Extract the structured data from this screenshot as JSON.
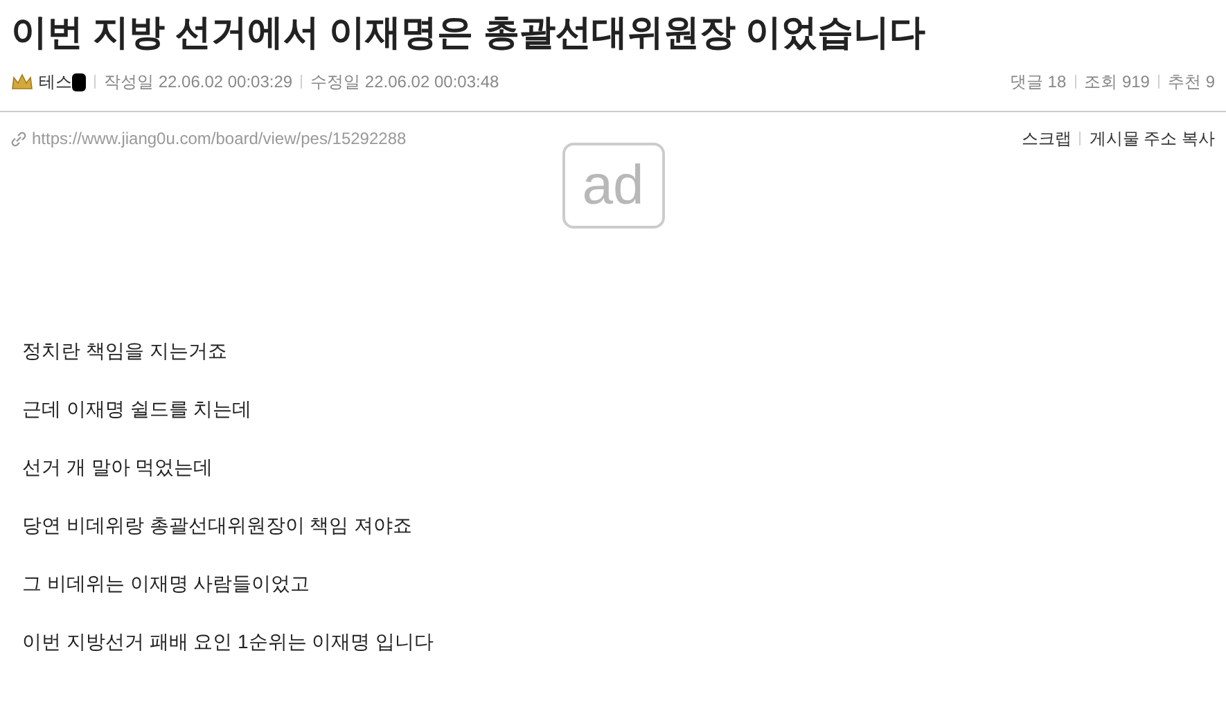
{
  "post": {
    "title": "이번 지방 선거에서 이재명은 총괄선대위원장 이었습니다",
    "author": "테스",
    "author_redacted": true,
    "written_label": "작성일",
    "written": "22.06.02 00:03:29",
    "edited_label": "수정일",
    "edited": "22.06.02 00:03:48",
    "stats": [
      {
        "label": "댓글",
        "value": "18"
      },
      {
        "label": "조회",
        "value": "919"
      },
      {
        "label": "추천",
        "value": "9"
      }
    ],
    "url": "https://www.jiang0u.com/board/view/pes/15292288",
    "actions": [
      "스크랩",
      "게시물 주소 복사"
    ],
    "ad": "ad",
    "body": [
      "정치란 책임을 지는거죠",
      "근데 이재명 쉴드를 치는데",
      "선거 개 말아 먹었는데",
      "당연 비데위랑 총괄선대위원장이 책임 져야죠",
      "그 비데위는 이재명 사람들이었고",
      "이번 지방선거 패배 요인 1순위는 이재명 입니다"
    ]
  }
}
